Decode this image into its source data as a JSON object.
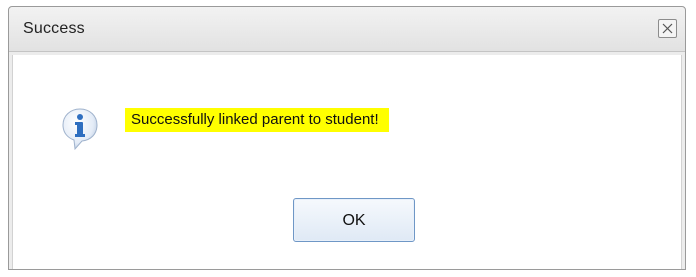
{
  "dialog": {
    "title": "Success",
    "message": "Successfully linked parent to student!",
    "ok_label": "OK",
    "icon": "info-icon",
    "close_icon": "close-icon"
  },
  "colors": {
    "message_highlight": "#ffff00",
    "icon_blue": "#2f6fc0",
    "button_border": "#6f97c6"
  }
}
